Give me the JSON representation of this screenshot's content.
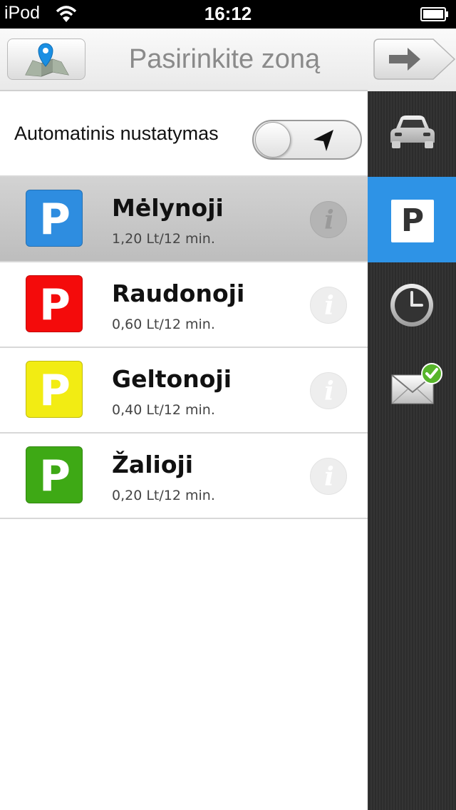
{
  "status_bar": {
    "carrier": "iPod",
    "time": "16:12"
  },
  "header": {
    "title": "Pasirinkite zoną",
    "map_icon": "map-pin-icon",
    "forward_icon": "arrow-right-icon"
  },
  "auto_detect": {
    "label": "Automatinis nustatymas",
    "enabled": false,
    "icon": "location-arrow-icon"
  },
  "zones": [
    {
      "name": "Mėlynoji",
      "price": "1,20 Lt/12 min.",
      "color": "#2e8de0",
      "badge": "P",
      "selected": true
    },
    {
      "name": "Raudonoji",
      "price": "0,60 Lt/12 min.",
      "color": "#f40b0b",
      "badge": "P",
      "selected": false
    },
    {
      "name": "Geltonoji",
      "price": "0,40 Lt/12 min.",
      "color": "#f2ec13",
      "badge": "P",
      "selected": false
    },
    {
      "name": "Žalioji",
      "price": "0,20 Lt/12 min.",
      "color": "#3ea915",
      "badge": "P",
      "selected": false
    }
  ],
  "info_glyph": "i",
  "sidebar": {
    "items": [
      {
        "icon": "car-icon",
        "active": false
      },
      {
        "icon": "parking-icon",
        "label": "P",
        "active": true
      },
      {
        "icon": "clock-icon",
        "active": false
      },
      {
        "icon": "mail-check-icon",
        "active": false
      }
    ],
    "active_color": "#2e93e6"
  }
}
